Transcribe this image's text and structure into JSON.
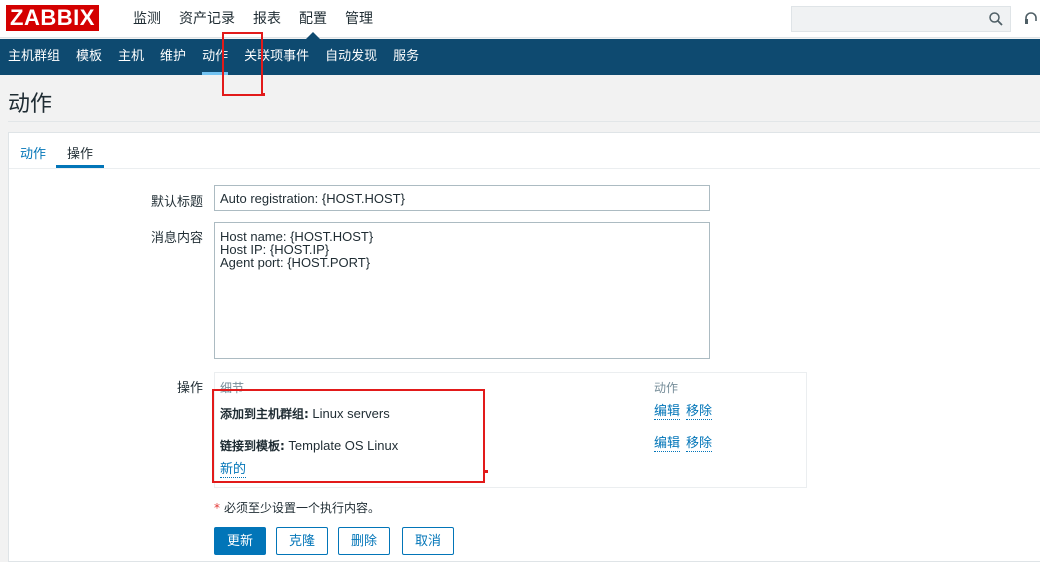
{
  "logo": "ZABBIX",
  "top_menu": [
    "监测",
    "资产记录",
    "报表",
    "配置",
    "管理"
  ],
  "search": {
    "placeholder": ""
  },
  "sub_menu": [
    "主机群组",
    "模板",
    "主机",
    "维护",
    "动作",
    "关联项事件",
    "自动发现",
    "服务"
  ],
  "page_title": "动作",
  "tabs": [
    "动作",
    "操作"
  ],
  "form": {
    "default_subject_label": "默认标题",
    "default_subject_value": "Auto registration: {HOST.HOST}",
    "message_label": "消息内容",
    "message_value": "Host name: {HOST.HOST}\nHost IP: {HOST.IP}\nAgent port: {HOST.PORT}",
    "operations_label": "操作"
  },
  "operations": {
    "col_details": "细节",
    "col_action": "动作",
    "rows": [
      {
        "bold": "添加到主机群组:",
        "value": " Linux servers",
        "edit": "编辑",
        "remove": "移除"
      },
      {
        "bold": "链接到模板:",
        "value": " Template OS Linux",
        "edit": "编辑",
        "remove": "移除"
      }
    ],
    "new_link": "新的"
  },
  "required_note": "必须至少设置一个执行内容。",
  "required_mark": "*",
  "buttons": {
    "update": "更新",
    "clone": "克隆",
    "delete": "删除",
    "cancel": "取消"
  },
  "colors": {
    "brand": "#d40000",
    "nav": "#0e4a70",
    "link": "#0275b8",
    "highlight": "#e21a1a"
  }
}
